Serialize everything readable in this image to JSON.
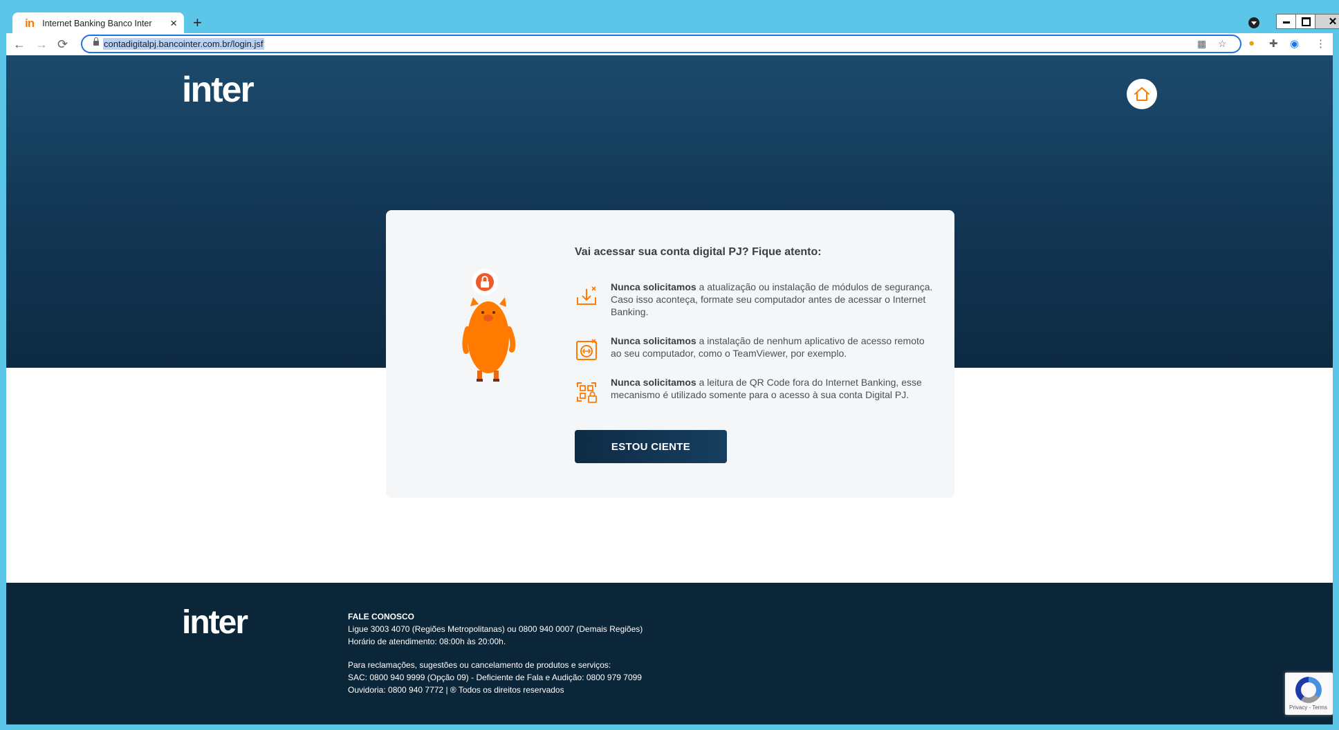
{
  "browser": {
    "tab_title": "Internet Banking Banco Inter",
    "tab_logo": "in",
    "new_tab": "+",
    "url": "contadigitalpj.bancointer.com.br/login.jsf",
    "window_buttons": [
      "▬",
      "❐",
      "✕"
    ]
  },
  "header": {
    "logo": "inter",
    "home_icon": "home-icon"
  },
  "notice": {
    "title": "Vai acessar sua conta digital PJ? Fique atento:",
    "items": [
      {
        "bold": "Nunca solicitamos",
        "text": " a atualização ou instalação de módulos de segurança. Caso isso aconteça, formate seu computador antes de acessar o Internet Banking.",
        "icon": "download-x-icon"
      },
      {
        "bold": "Nunca solicitamos",
        "text": " a instalação de nenhum aplicativo de acesso remoto ao seu computador, como o TeamViewer, por exemplo.",
        "icon": "remote-access-x-icon"
      },
      {
        "bold": "Nunca solicitamos",
        "text": " a leitura de QR Code fora do Internet Banking, esse mecanismo é utilizado somente para o acesso à sua conta Digital PJ.",
        "icon": "qr-lock-icon"
      }
    ],
    "button_label": "ESTOU CIENTE"
  },
  "footer": {
    "logo": "inter",
    "heading": "FALE CONOSCO",
    "line1": "Ligue 3003 4070 (Regiões Metropolitanas) ou 0800 940 0007 (Demais Regiões)",
    "line2": "Horário de atendimento: 08:00h às 20:00h.",
    "line3": "Para reclamações, sugestões ou cancelamento de produtos e serviços:",
    "line4": "SAC: 0800 940 9999 (Opção 09) - Deficiente de Fala e Audição: 0800 979 7099",
    "line5": "Ouvidoria: 0800 940 7772 | ® Todos os direitos reservados"
  },
  "recaptcha": {
    "text": "Privacy - Terms"
  },
  "colors": {
    "brand_orange": "#ff7a00",
    "hero_dark": "#123553",
    "footer_dark": "#0c2639",
    "chrome_frame": "#5cc6e8"
  }
}
